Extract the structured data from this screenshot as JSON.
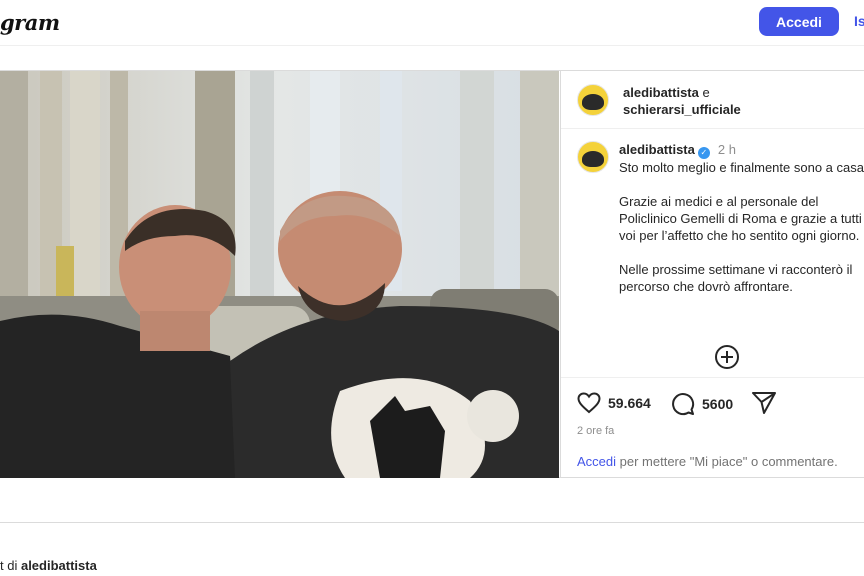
{
  "header": {
    "logo": "gram",
    "login_button": "Accedi",
    "signup_link": "Iscriviti"
  },
  "post": {
    "photo_alt": "",
    "collab_header": {
      "user1": "aledibattista",
      "conj": "e",
      "user2": "schierarsi_ufficiale"
    },
    "caption": {
      "username": "aledibattista",
      "time": "2 h",
      "body": "Sto molto meglio e finalmente sono a casa!\n\nGrazie ai medici e al personale del Policlinico Gemelli di Roma e grazie a tutti voi per l’affetto che ho sentito ogni giorno.\n\nNelle prossime settimane vi racconterò il percorso che dovrò affrontare."
    },
    "likes": "59.664",
    "comments": "5600",
    "time_ago": "2 ore fa",
    "login_prompt": {
      "link": "Accedi",
      "text": " per mettere \"Mi piace\" o commentare."
    }
  },
  "footer": {
    "prefix": "t di ",
    "user": "aledibattista"
  },
  "colors": {
    "accent": "#4355e8",
    "verified": "#3897f0"
  }
}
